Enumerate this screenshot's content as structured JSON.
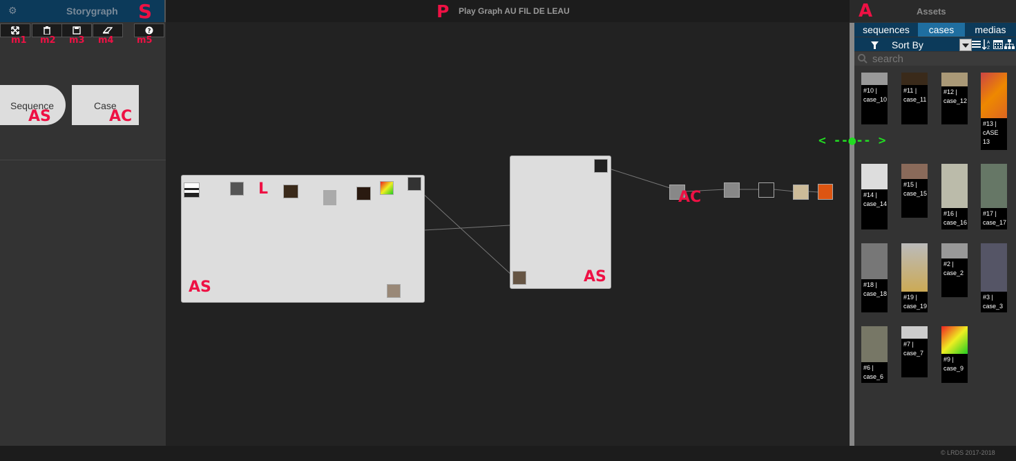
{
  "storygraph_panel": {
    "title": "Storygraph",
    "toolbar_labels": [
      "m1",
      "m2",
      "m3",
      "m4",
      "m5"
    ],
    "nodes": {
      "sequence": "Sequence",
      "case": "Case"
    }
  },
  "annotations": {
    "s": "S",
    "p": "P",
    "a": "A",
    "l": "L",
    "as": "AS",
    "ac": "AC",
    "resize": "< --●-- >"
  },
  "play_graph": {
    "title": "Play Graph AU FIL DE LEAU"
  },
  "assets": {
    "title": "Assets",
    "tabs": [
      {
        "label": "sequences"
      },
      {
        "label": "cases",
        "active": true
      },
      {
        "label": "medias"
      }
    ],
    "sort_label": "Sort By",
    "search_placeholder": "search",
    "cards": [
      {
        "caption": "#10 |\ncase_10"
      },
      {
        "caption": "#11 |\ncase_11"
      },
      {
        "caption": "#12 |\ncase_12"
      },
      {
        "caption": "#13 |\ncASE\n13"
      },
      {
        "caption": "#14 |\ncase_14"
      },
      {
        "caption": "#15 |\ncase_15"
      },
      {
        "caption": "#16 |\ncase_16"
      },
      {
        "caption": "#17 |\ncase_17"
      },
      {
        "caption": "#18 |\ncase_18"
      },
      {
        "caption": "#19 |\ncase_19"
      },
      {
        "caption": "#2 |\ncase_2"
      },
      {
        "caption": "#3 |\ncase_3"
      },
      {
        "caption": "#6 |\ncase_6"
      },
      {
        "caption": "#7 |\ncase_7"
      },
      {
        "caption": "#9 |\ncase_9"
      }
    ]
  },
  "footer": {
    "copyright": "©  LRDS 2017-2018"
  },
  "colors": {
    "accent_blue": "#0c3a5a",
    "annotation_red": "#ee1144",
    "annotation_green": "#22dd22"
  },
  "icons": [
    "gear-icon",
    "expand-icon",
    "trash-icon",
    "save-icon",
    "eraser-icon",
    "help-icon",
    "filter-icon",
    "search-icon",
    "dropdown-icon",
    "list-icon",
    "sort-az-icon",
    "calendar-icon",
    "hierarchy-icon"
  ]
}
